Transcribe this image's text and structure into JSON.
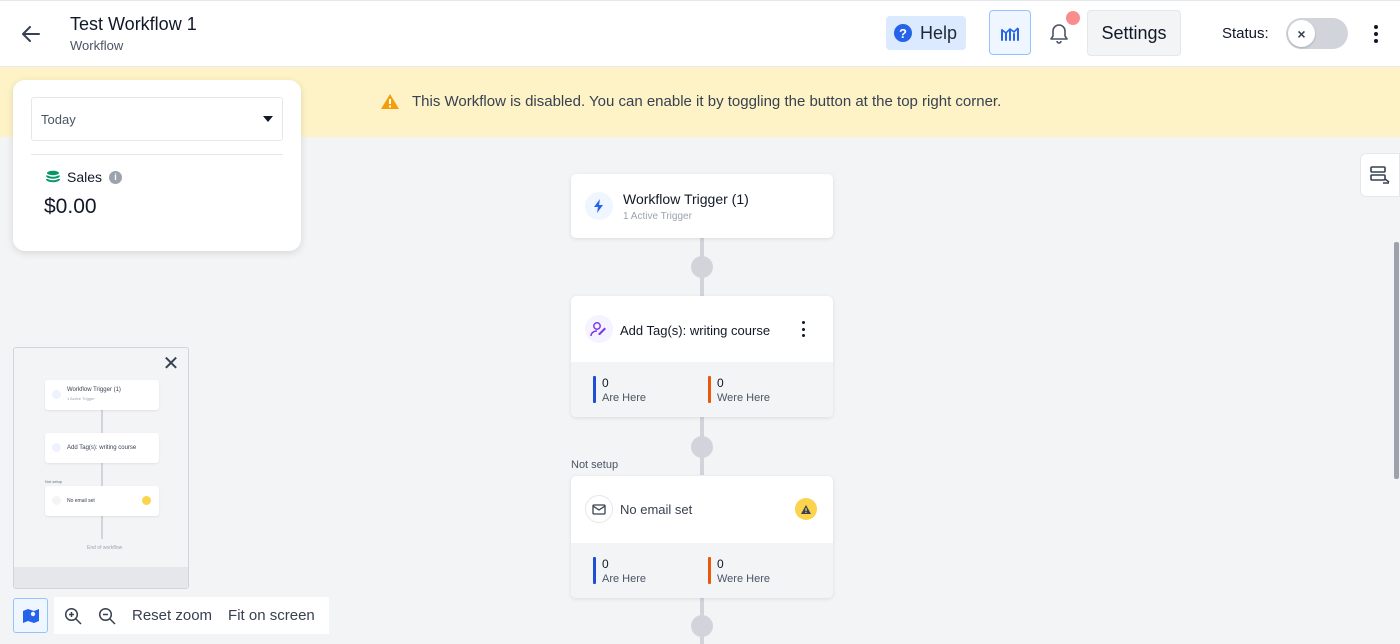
{
  "header": {
    "title": "Test Workflow 1",
    "subtitle": "Workflow",
    "help_label": "Help",
    "settings_label": "Settings",
    "status_label": "Status:",
    "status_toggle_icon": "×"
  },
  "banner": {
    "message": "This Workflow is disabled. You can enable it by toggling the button at the top right corner."
  },
  "stats": {
    "date_range": "Today",
    "metric_label": "Sales",
    "metric_value": "$0.00"
  },
  "nodes": {
    "trigger": {
      "title": "Workflow Trigger (1)",
      "subtitle": "1 Active Trigger"
    },
    "add_tag": {
      "title": "Add Tag(s): writing course",
      "are_here_count": "0",
      "are_here_label": "Are Here",
      "were_here_count": "0",
      "were_here_label": "Were Here"
    },
    "email": {
      "section_label": "Not setup",
      "title": "No email set",
      "are_here_count": "0",
      "are_here_label": "Are Here",
      "were_here_count": "0",
      "were_here_label": "Were Here"
    }
  },
  "minimap": {
    "close_glyph": "✕",
    "trigger_title": "Workflow Trigger (1)",
    "trigger_sub": "1 Active Trigger",
    "tag_title": "Add Tag(s): writing course",
    "not_setup": "Not setup",
    "email_title": "No email set",
    "end_label": "End of workflow"
  },
  "zoom": {
    "reset_label": "Reset zoom",
    "fit_label": "Fit on screen"
  },
  "colors": {
    "accent": "#2563eb",
    "banner_bg": "#fdf3c7",
    "warning": "#f59e0b",
    "are_here_bar": "#1d4ed8",
    "were_here_bar": "#ea580c",
    "sales_icon": "#059669",
    "tag_icon": "#7c3aed"
  }
}
